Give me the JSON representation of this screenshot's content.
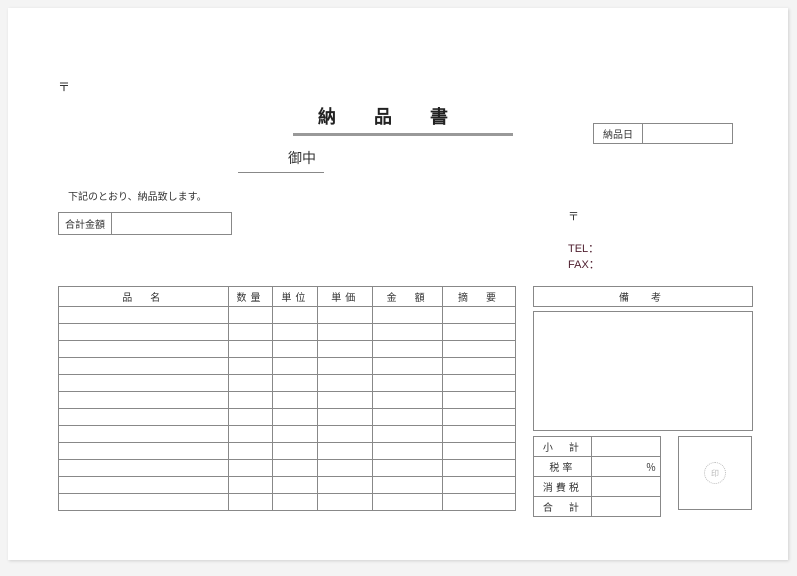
{
  "postal_mark": "〒",
  "title": "納　品　書",
  "date": {
    "label": "納品日",
    "value": ""
  },
  "addressee_suffix": "御中",
  "intro_text": "下記のとおり、納品致します。",
  "total": {
    "label": "合計金額",
    "value": ""
  },
  "sender_postal_mark": "〒",
  "tel_label": "TEL：",
  "fax_label": "FAX：",
  "items_headers": {
    "name": "品　名",
    "qty": "数量",
    "unit": "単位",
    "price": "単価",
    "amount": "金　額",
    "note": "摘　要"
  },
  "items_row_count": 12,
  "remarks": {
    "header": "備　考",
    "body": ""
  },
  "totals": {
    "subtotal_label": "小　計",
    "subtotal_value": "",
    "taxrate_label": "税率",
    "taxrate_value": "％",
    "tax_label": "消費税",
    "tax_value": "",
    "grand_label": "合　計",
    "grand_value": ""
  },
  "stamp_label": "印"
}
